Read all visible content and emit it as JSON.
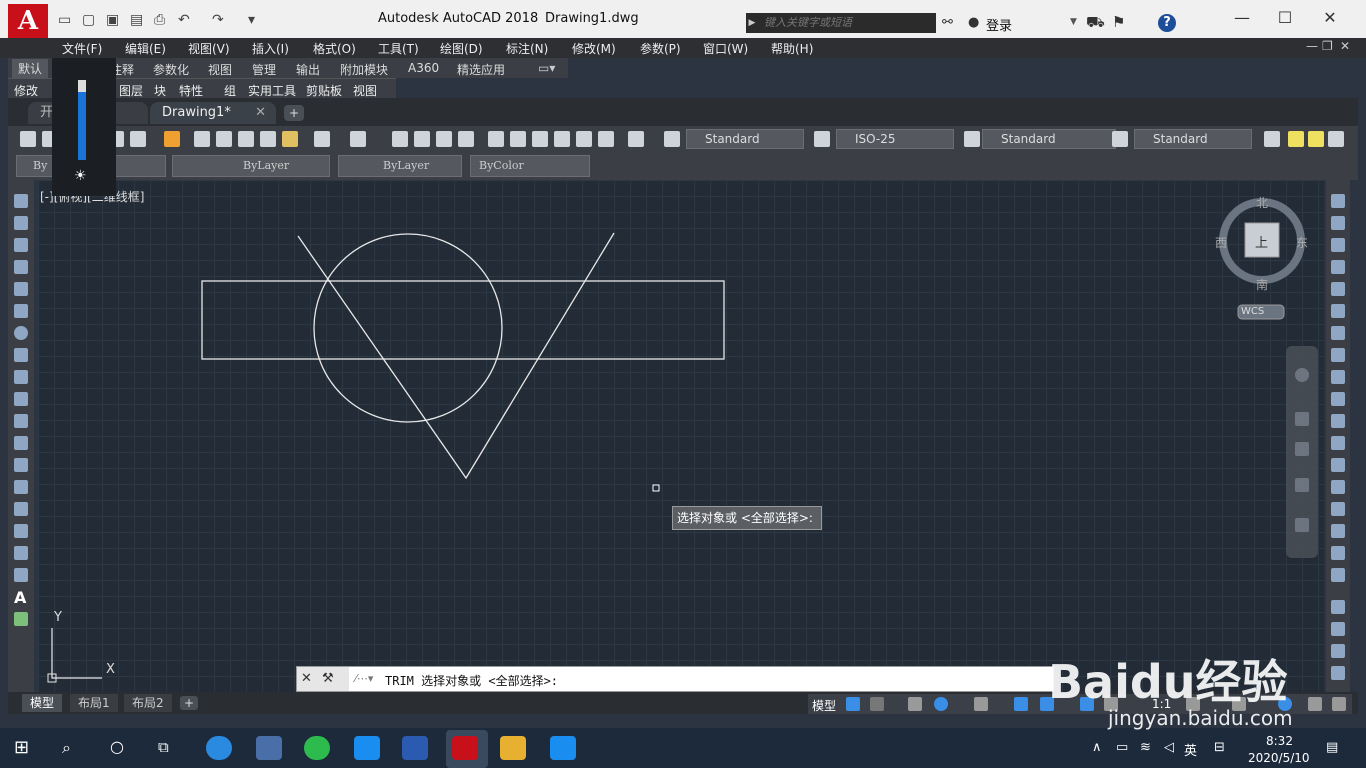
{
  "title_bar": {
    "app_title": "Autodesk AutoCAD 2018",
    "file_name": "Drawing1.dwg",
    "search_placeholder": "键入关键字或短语",
    "login_label": "登录",
    "logo_letter": "A",
    "help_icon": "?"
  },
  "menu": [
    "文件(F)",
    "编辑(E)",
    "视图(V)",
    "插入(I)",
    "格式(O)",
    "工具(T)",
    "绘图(D)",
    "标注(N)",
    "修改(M)",
    "参数(P)",
    "窗口(W)",
    "帮助(H)"
  ],
  "ribbon_tabs": [
    "默认",
    "注释",
    "参数化",
    "视图",
    "管理",
    "输出",
    "附加模块",
    "A360",
    "精选应用"
  ],
  "panels": [
    "修改",
    "图层",
    "块",
    "特性",
    "组",
    "实用工具",
    "剪贴板",
    "视图"
  ],
  "file_tabs": {
    "start": "开始",
    "active": "Drawing1*"
  },
  "styles": {
    "text": "Standard",
    "dim": "ISO-25",
    "table": "Standard",
    "mleader": "Standard"
  },
  "props": {
    "layer": "ByLayer",
    "linetype1": "ByLayer",
    "linetype2": "ByLayer",
    "color": "ByColor",
    "layer_short": "By"
  },
  "viewport_label": "[-][俯视][二维线框]",
  "viewcube": {
    "north": "北",
    "south": "南",
    "east": "东",
    "west": "西",
    "top": "上",
    "wcs": "WCS"
  },
  "ucs": {
    "x": "X",
    "y": "Y"
  },
  "tooltip": "选择对象或 <全部选择>:",
  "command_line": "TRIM 选择对象或 <全部选择>:",
  "layout_tabs": [
    "模型",
    "布局1",
    "布局2"
  ],
  "status": {
    "model": "模型",
    "scale": "1:1"
  },
  "taskbar": {
    "ime": "英",
    "time": "8:32",
    "date": "2020/5/10"
  },
  "watermark": {
    "brand": "Baidu经验",
    "url": "jingyan.baidu.com"
  },
  "colors": {
    "canvas": "#222b36",
    "accent": "#c8101a",
    "geometry": "#e8e8e8"
  }
}
